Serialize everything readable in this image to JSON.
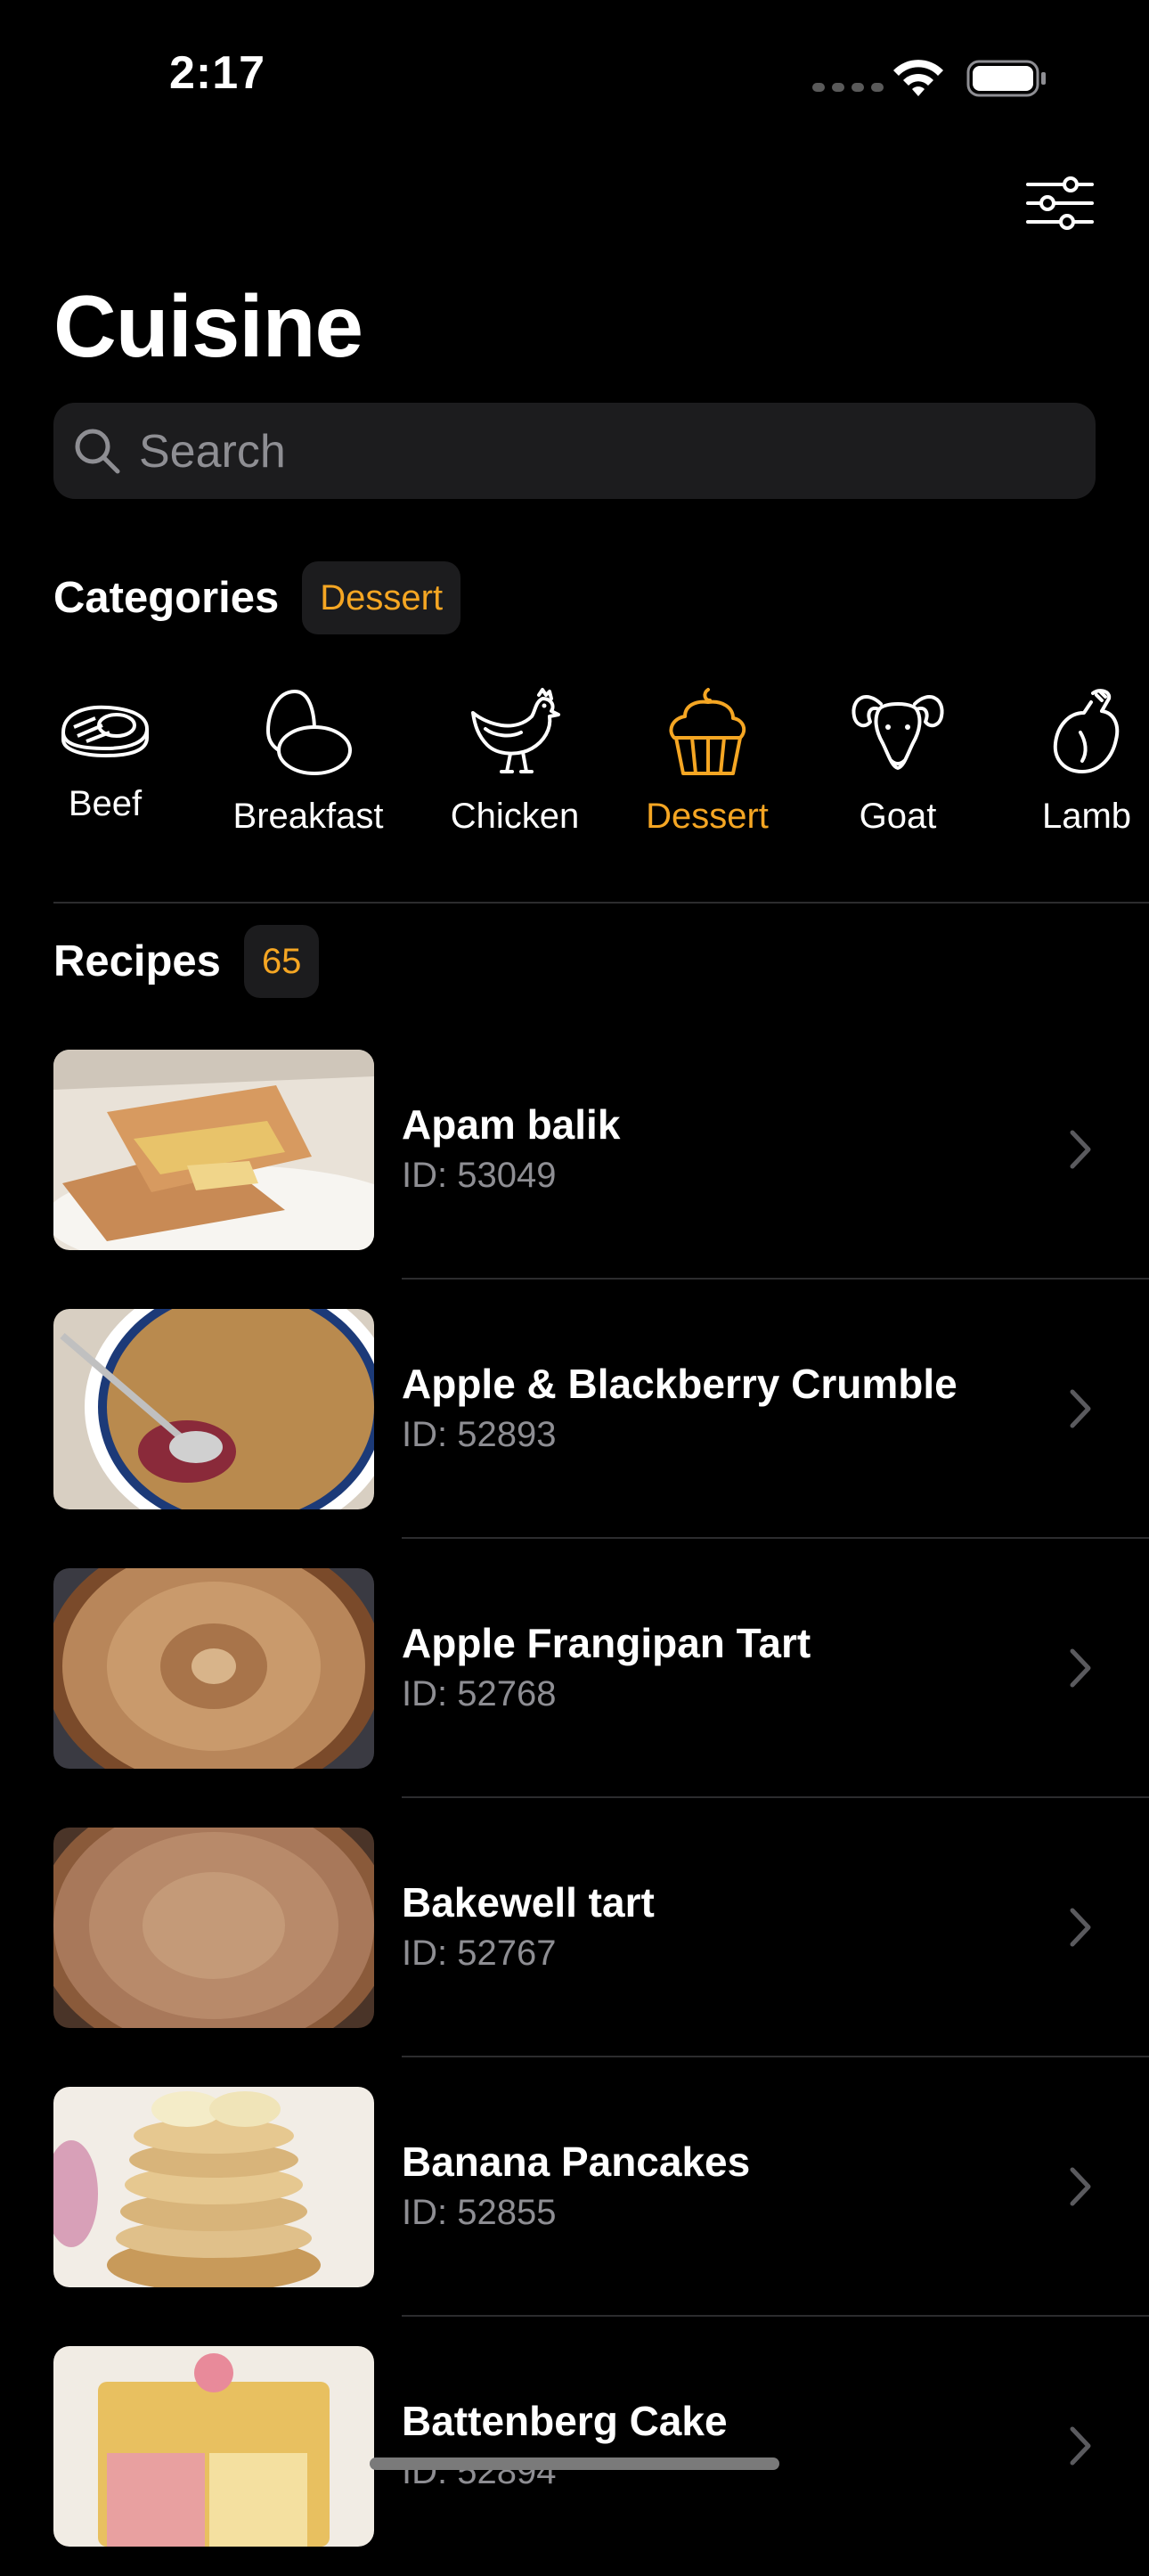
{
  "status_bar": {
    "time": "2:17"
  },
  "title": "Cuisine",
  "search": {
    "placeholder": "Search"
  },
  "categories_section": {
    "label": "Categories",
    "selected_chip": "Dessert",
    "items": [
      {
        "label": "Beef",
        "icon": "steak-icon"
      },
      {
        "label": "Breakfast",
        "icon": "eggs-icon"
      },
      {
        "label": "Chicken",
        "icon": "chicken-icon"
      },
      {
        "label": "Dessert",
        "icon": "cupcake-icon",
        "selected": true
      },
      {
        "label": "Goat",
        "icon": "goat-icon"
      },
      {
        "label": "Lamb",
        "icon": "lamb-icon"
      }
    ]
  },
  "recipes_section": {
    "label": "Recipes",
    "count": "65",
    "items": [
      {
        "title": "Apam balik",
        "id": "ID: 53049"
      },
      {
        "title": "Apple & Blackberry Crumble",
        "id": "ID: 52893"
      },
      {
        "title": "Apple Frangipan Tart",
        "id": "ID: 52768"
      },
      {
        "title": "Bakewell tart",
        "id": "ID: 52767"
      },
      {
        "title": "Banana Pancakes",
        "id": "ID: 52855"
      },
      {
        "title": "Battenberg Cake",
        "id": "ID: 52894"
      }
    ]
  },
  "colors": {
    "accent": "#f5a623",
    "background": "#000000",
    "field": "#1c1c1e",
    "secondary_text": "#8e8e93"
  }
}
